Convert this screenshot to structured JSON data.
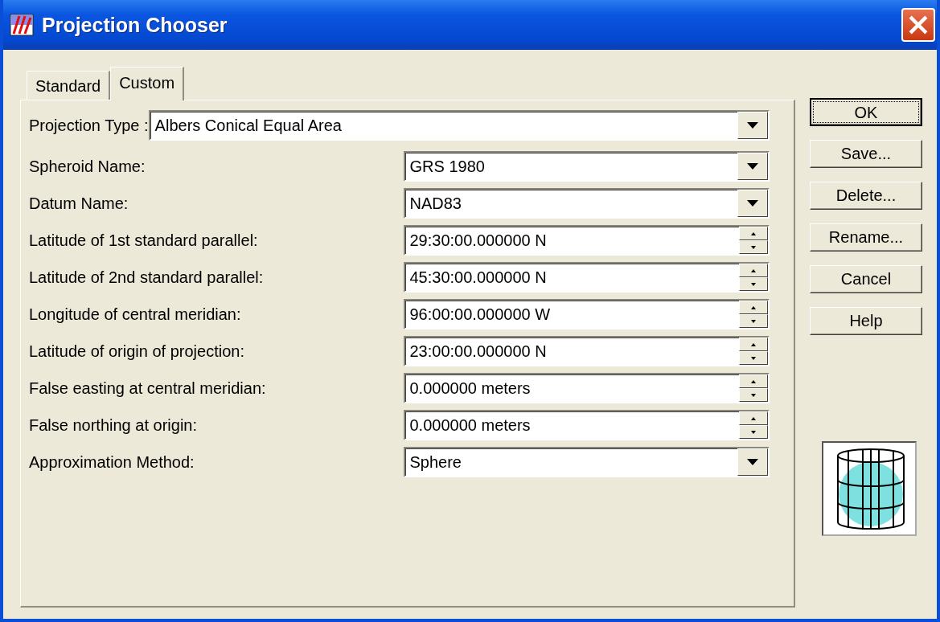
{
  "window": {
    "title": "Projection Chooser"
  },
  "tabs": [
    {
      "label": "Standard",
      "selected": false
    },
    {
      "label": "Custom",
      "selected": true
    }
  ],
  "projection_type": {
    "label": "Projection Type :",
    "value": "Albers Conical Equal Area"
  },
  "fields": [
    {
      "label": "Spheroid Name:",
      "value": "GRS 1980",
      "kind": "dropdown"
    },
    {
      "label": "Datum Name:",
      "value": "NAD83",
      "kind": "dropdown"
    },
    {
      "label": "Latitude of 1st standard parallel:",
      "value": "29:30:00.000000 N",
      "kind": "spin"
    },
    {
      "label": "Latitude of 2nd standard parallel:",
      "value": "45:30:00.000000 N",
      "kind": "spin"
    },
    {
      "label": "Longitude of central meridian:",
      "value": "96:00:00.000000 W",
      "kind": "spin"
    },
    {
      "label": "Latitude of origin of projection:",
      "value": "23:00:00.000000 N",
      "kind": "spin"
    },
    {
      "label": "False easting at central meridian:",
      "value": "0.000000 meters",
      "kind": "spin"
    },
    {
      "label": "False northing at origin:",
      "value": "0.000000 meters",
      "kind": "spin"
    },
    {
      "label": "Approximation Method:",
      "value": "Sphere",
      "kind": "dropdown"
    }
  ],
  "buttons": [
    {
      "label": "OK",
      "default": true
    },
    {
      "label": "Save...",
      "default": false
    },
    {
      "label": "Delete...",
      "default": false
    },
    {
      "label": "Rename...",
      "default": false
    },
    {
      "label": "Cancel",
      "default": false
    },
    {
      "label": "Help",
      "default": false
    }
  ]
}
